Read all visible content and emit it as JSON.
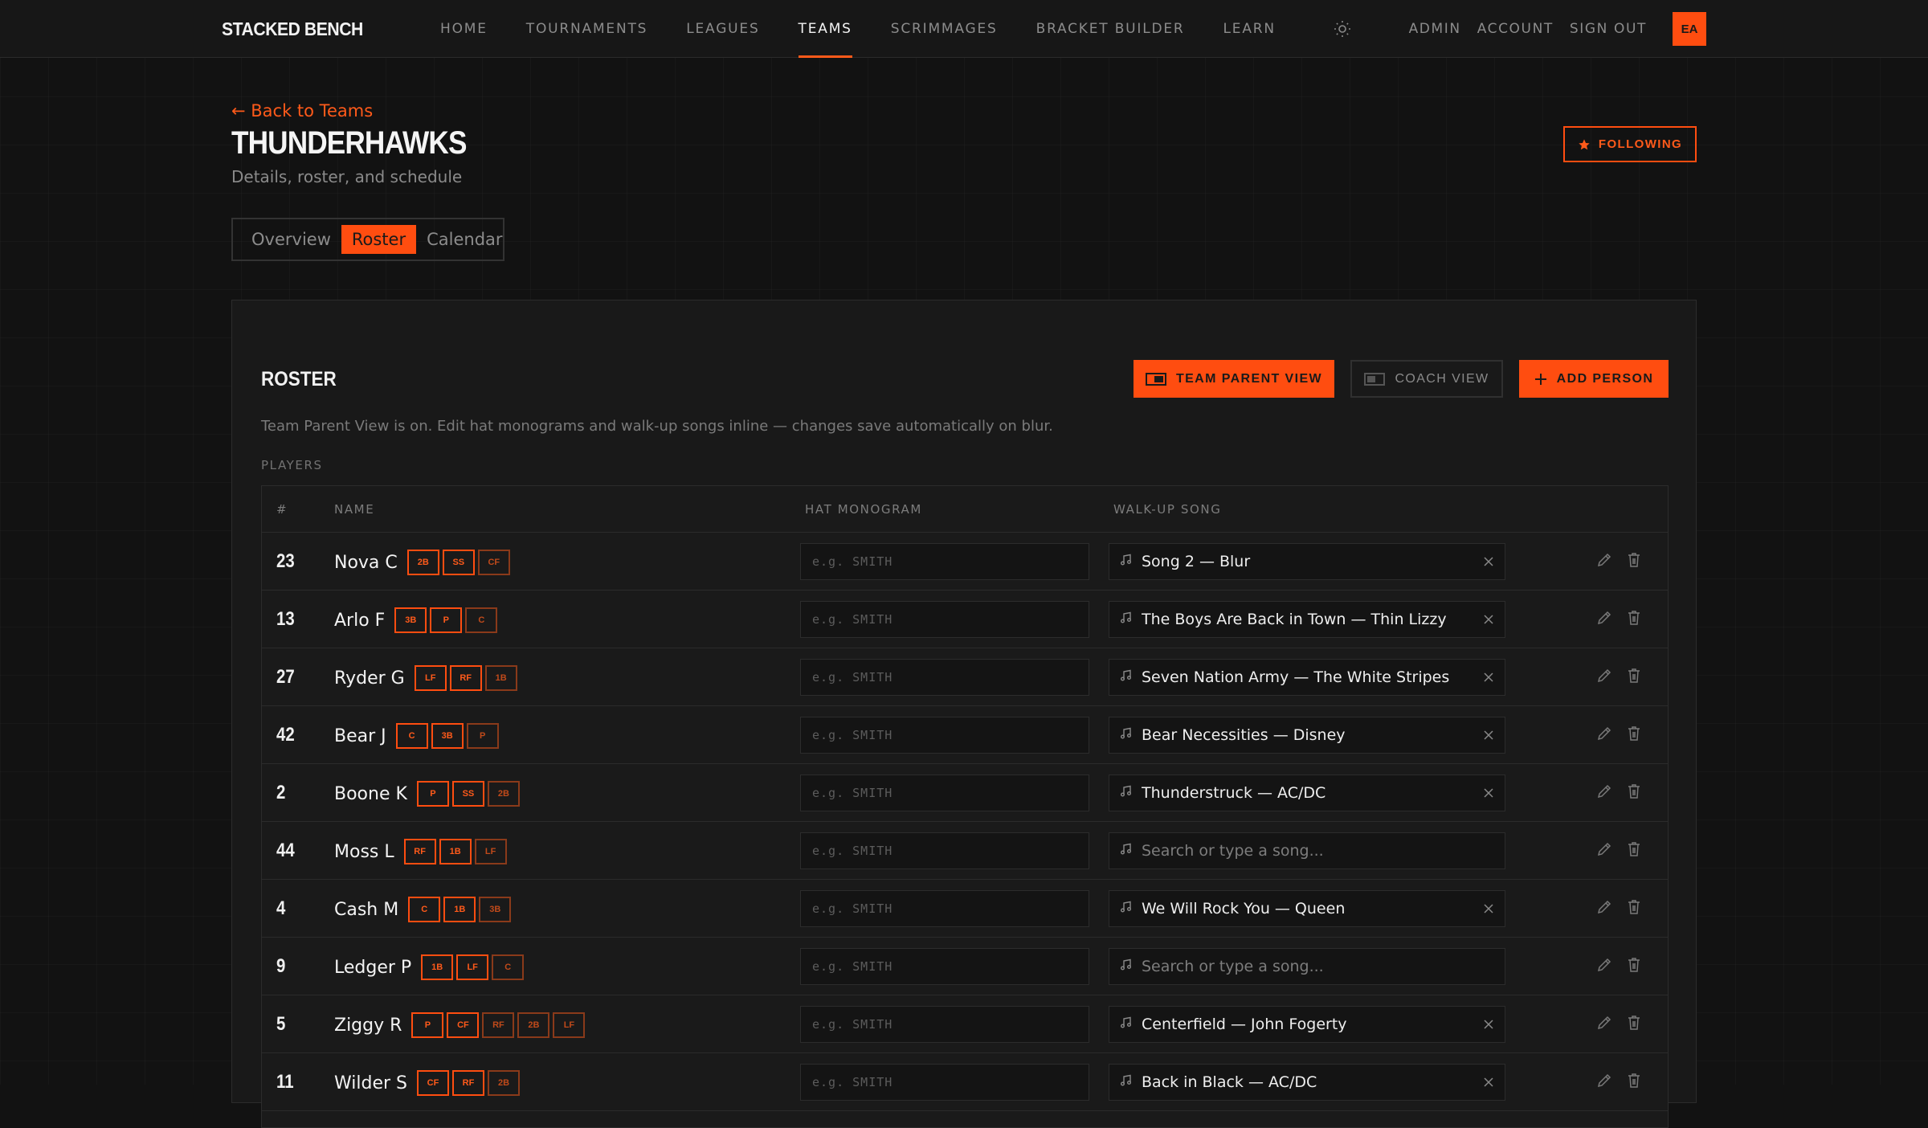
{
  "nav": {
    "brand": "STACKED BENCH",
    "links": [
      "HOME",
      "TOURNAMENTS",
      "LEAGUES",
      "TEAMS",
      "SCRIMMAGES",
      "BRACKET BUILDER",
      "LEARN"
    ],
    "active": "TEAMS",
    "right_links": [
      "ADMIN",
      "ACCOUNT",
      "SIGN OUT"
    ],
    "avatar": "EA"
  },
  "header": {
    "back": "← Back to Teams",
    "title": "THUNDERHAWKS",
    "subtitle": "Details, roster, and schedule",
    "following": "FOLLOWING"
  },
  "tabs": [
    "Overview",
    "Roster",
    "Calendar"
  ],
  "active_tab": "Roster",
  "roster": {
    "title": "ROSTER",
    "team_parent_view": "TEAM PARENT VIEW",
    "coach_view": "COACH VIEW",
    "add_person": "ADD PERSON",
    "description": "Team Parent View is on. Edit hat monograms and walk-up songs inline — changes save automatically on blur.",
    "section_label": "PLAYERS",
    "columns": [
      "#",
      "NAME",
      "HAT MONOGRAM",
      "WALK-UP SONG"
    ],
    "monogram_placeholder": "e.g. SMITH",
    "song_placeholder": "Search or type a song...",
    "players": [
      {
        "num": "23",
        "name": "Nova C",
        "positions": [
          "2B",
          "SS",
          "CF"
        ],
        "song": "Song 2 — Blur"
      },
      {
        "num": "13",
        "name": "Arlo F",
        "positions": [
          "3B",
          "P",
          "C"
        ],
        "song": "The Boys Are Back in Town — Thin Lizzy"
      },
      {
        "num": "27",
        "name": "Ryder G",
        "positions": [
          "LF",
          "RF",
          "1B"
        ],
        "song": "Seven Nation Army — The White Stripes"
      },
      {
        "num": "42",
        "name": "Bear J",
        "positions": [
          "C",
          "3B",
          "P"
        ],
        "song": "Bear Necessities — Disney"
      },
      {
        "num": "2",
        "name": "Boone K",
        "positions": [
          "P",
          "SS",
          "2B"
        ],
        "song": "Thunderstruck — AC/DC"
      },
      {
        "num": "44",
        "name": "Moss L",
        "positions": [
          "RF",
          "1B",
          "LF"
        ],
        "song": ""
      },
      {
        "num": "4",
        "name": "Cash M",
        "positions": [
          "C",
          "1B",
          "3B"
        ],
        "song": "We Will Rock You — Queen"
      },
      {
        "num": "9",
        "name": "Ledger P",
        "positions": [
          "1B",
          "LF",
          "C"
        ],
        "song": ""
      },
      {
        "num": "5",
        "name": "Ziggy R",
        "positions": [
          "P",
          "CF",
          "RF",
          "2B",
          "LF"
        ],
        "song": "Centerfield — John Fogerty"
      },
      {
        "num": "11",
        "name": "Wilder S",
        "positions": [
          "CF",
          "RF",
          "2B"
        ],
        "song": "Back in Black — AC/DC"
      }
    ]
  },
  "colors": {
    "accent": "#ff4d10",
    "background": "#121212",
    "card": "#191919"
  }
}
